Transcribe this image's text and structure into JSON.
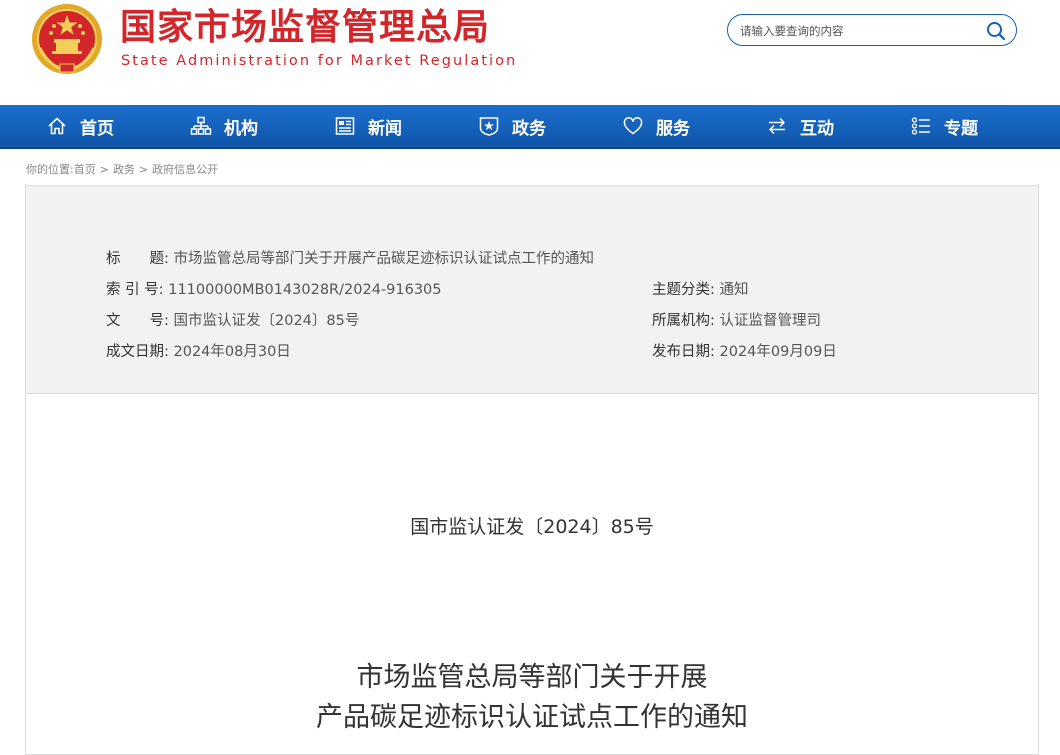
{
  "header": {
    "title_cn": "国家市场监督管理总局",
    "title_en": "State Administration for Market Regulation",
    "search": {
      "placeholder": "请输入要查询的内容"
    },
    "colors": {
      "brand_red": "#d3262b",
      "nav_blue": "#1560b8"
    }
  },
  "nav": {
    "items": [
      {
        "label": "首页",
        "icon": "home-icon"
      },
      {
        "label": "机构",
        "icon": "org-chart-icon"
      },
      {
        "label": "新闻",
        "icon": "newspaper-icon"
      },
      {
        "label": "政务",
        "icon": "shield-star-icon"
      },
      {
        "label": "服务",
        "icon": "heart-icon"
      },
      {
        "label": "互动",
        "icon": "exchange-arrows-icon"
      },
      {
        "label": "专题",
        "icon": "topic-list-icon"
      }
    ]
  },
  "breadcrumb": {
    "prefix": "你的位置:",
    "items": [
      "首页",
      "政务",
      "政府信息公开"
    ],
    "separator": ">"
  },
  "meta": {
    "title_label": "标　　题:",
    "title_value": "市场监管总局等部门关于开展产品碳足迹标识认证试点工作的通知",
    "index_label": "索 引 号:",
    "index_value": "11100000MB0143028R/2024-916305",
    "subject_label": "主题分类:",
    "subject_value": "通知",
    "docno_label": "文　　号:",
    "docno_value": "国市监认证发〔2024〕85号",
    "dept_label": "所属机构:",
    "dept_value": "认证监督管理司",
    "created_label": "成文日期:",
    "created_value": "2024年08月30日",
    "published_label": "发布日期:",
    "published_value": "2024年09月09日"
  },
  "document": {
    "number": "国市监认证发〔2024〕85号",
    "title_line1": "市场监管总局等部门关于开展",
    "title_line2": "产品碳足迹标识认证试点工作的通知"
  }
}
